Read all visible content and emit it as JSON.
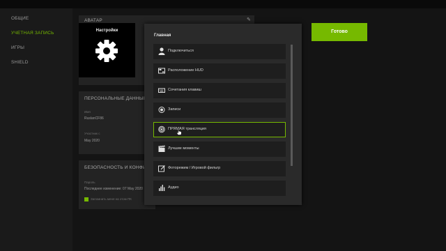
{
  "sidebar": {
    "items": [
      {
        "label": "ОБЩИЕ",
        "active": false
      },
      {
        "label": "УЧЕТНАЯ ЗАПИСЬ",
        "active": true
      },
      {
        "label": "ИГРЫ",
        "active": false
      },
      {
        "label": "SHIELD",
        "active": false
      }
    ]
  },
  "avatar": {
    "section_title": "АВАТАР",
    "tile_title": "Настройки",
    "icon": "gear-icon"
  },
  "personal": {
    "section_title": "ПЕРСОНАЛЬНЫЕ ДАННЫЕ",
    "name_label": "Имя",
    "name_value": "RuslanCF86",
    "member_label": "Участник с",
    "member_value": "May 2020"
  },
  "security": {
    "section_title": "БЕЗОПАСНОСТЬ И КОНФИДЕ",
    "password_label": "Пароль",
    "last_changed": "Последнее изменение: 07 May 2020",
    "remember_label": "Запомнить меня на этом ПК"
  },
  "done_button": "Готово",
  "overlay": {
    "header": "Главная",
    "items": [
      {
        "label": "Подключиться",
        "icon": "user-icon",
        "selected": false
      },
      {
        "label": "Расположение HUD",
        "icon": "hud-icon",
        "selected": false
      },
      {
        "label": "Сочетания клавиш",
        "icon": "keyboard-icon",
        "selected": false
      },
      {
        "label": "Записи",
        "icon": "record-icon",
        "selected": false
      },
      {
        "label": "ПРЯМАЯ трансляция",
        "icon": "broadcast-icon",
        "selected": true
      },
      {
        "label": "Лучшие моменты",
        "icon": "clapper-icon",
        "selected": false
      },
      {
        "label": "Фоторежим / Игровой фильтр",
        "icon": "photo-filter-icon",
        "selected": false
      },
      {
        "label": "Аудио",
        "icon": "audio-icon",
        "selected": false
      }
    ]
  },
  "colors": {
    "accent": "#76b900",
    "panel": "#2a2a2a",
    "item": "#1e1e1e"
  }
}
